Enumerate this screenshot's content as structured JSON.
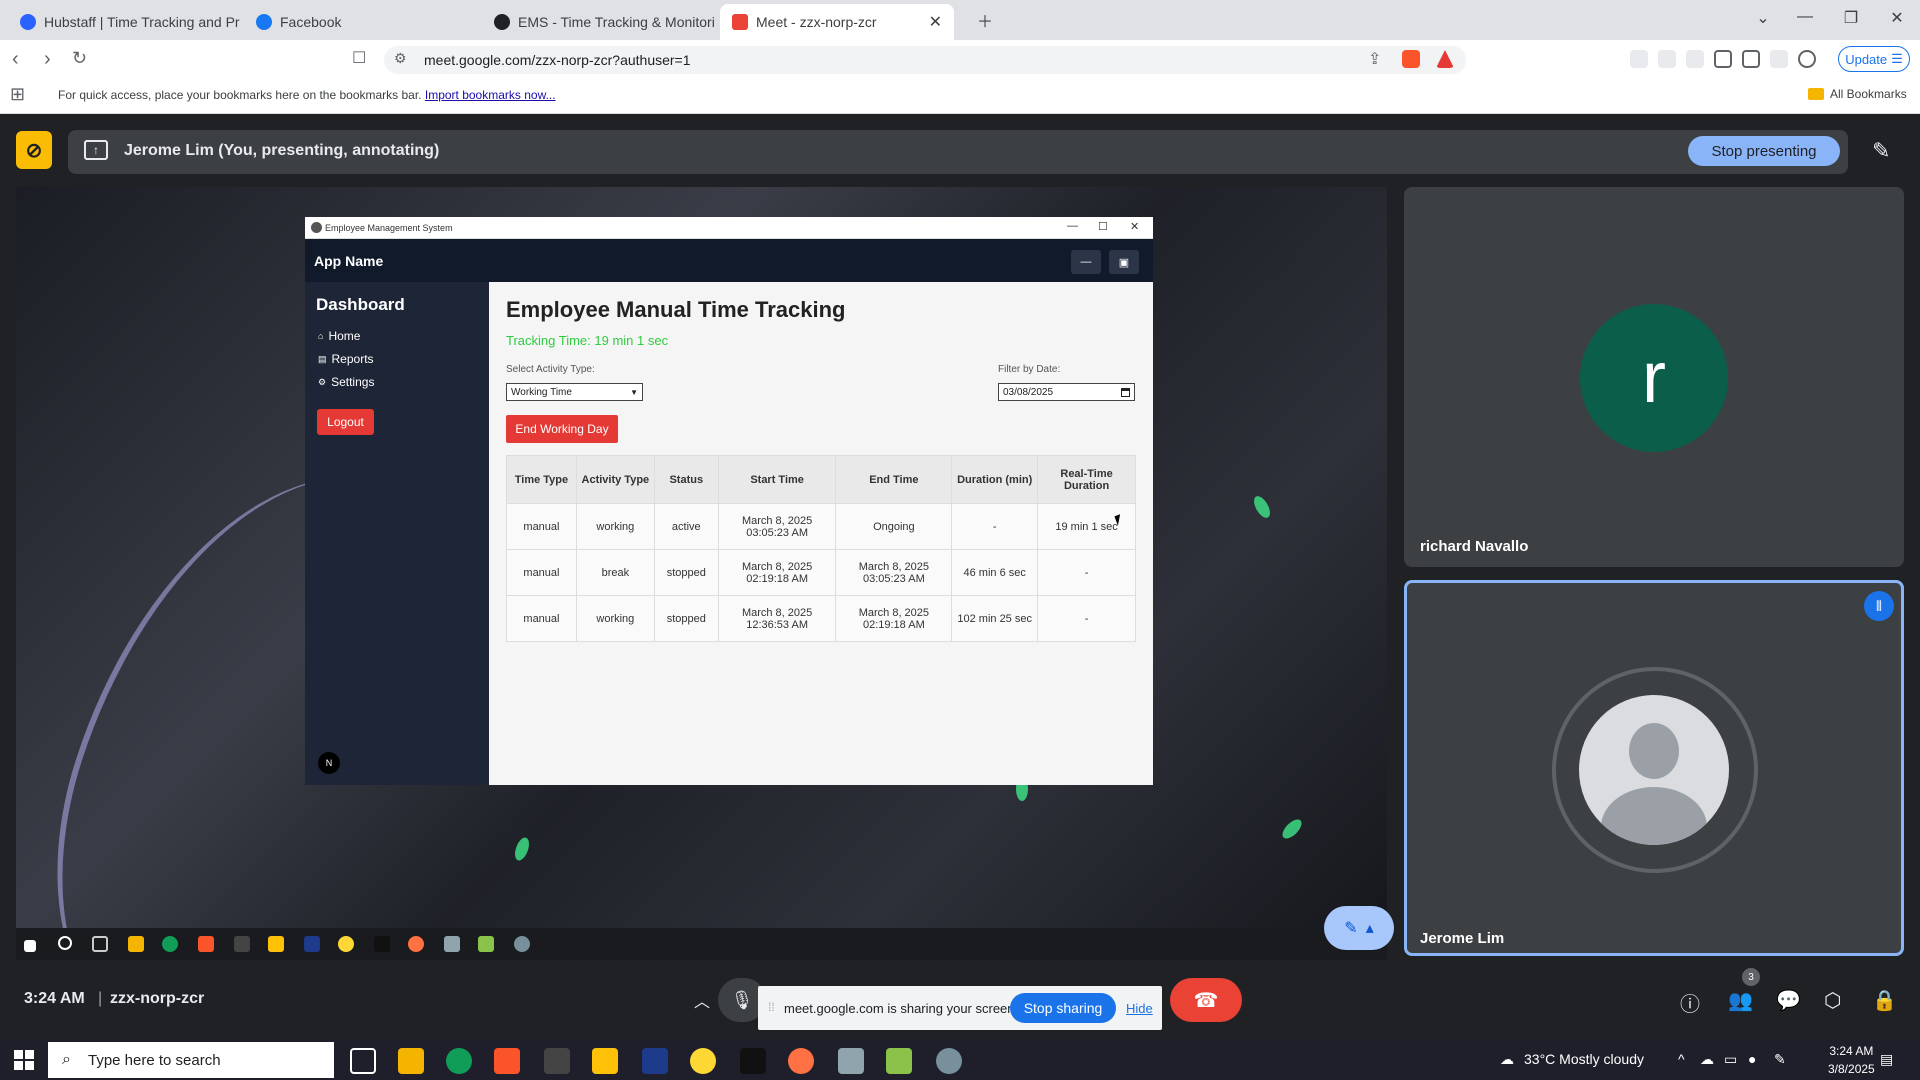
{
  "browser": {
    "tabs": [
      {
        "label": "Hubstaff | Time Tracking and Produ",
        "color": "#2962ff"
      },
      {
        "label": "Facebook",
        "color": "#1877f2"
      },
      {
        "label": "EMS - Time Tracking & Monitoring",
        "color": "#202124"
      },
      {
        "label": "Meet - zzx-norp-zcr",
        "color": "#ea4335"
      }
    ],
    "url": "meet.google.com/zzx-norp-zcr?authuser=1",
    "update_label": "Update",
    "bookmarks_prompt": "For quick access, place your bookmarks here on the bookmarks bar.",
    "import_link": "Import bookmarks now...",
    "all_bookmarks": "All Bookmarks"
  },
  "meet": {
    "presenting_title": "Jerome Lim (You, presenting, annotating)",
    "stop_presenting": "Stop presenting",
    "participants": [
      {
        "name": "richard Navallo",
        "initial": "r",
        "avatar_color": "#0b5e4a"
      },
      {
        "name": "Jerome Lim"
      }
    ],
    "time": "3:24 AM",
    "separator": "|",
    "meeting_code": "zzx-norp-zcr",
    "share_notice": "meet.google.com is sharing your screen.",
    "stop_sharing": "Stop sharing",
    "hide": "Hide",
    "people_count": "3"
  },
  "ems": {
    "window_title": "Employee Management System",
    "app_name": "App Name",
    "sidebar": {
      "title": "Dashboard",
      "items": [
        {
          "icon": "home-icon",
          "glyph": "⌂",
          "label": "Home"
        },
        {
          "icon": "reports-icon",
          "glyph": "▤",
          "label": "Reports"
        },
        {
          "icon": "settings-icon",
          "glyph": "⚙",
          "label": "Settings"
        }
      ],
      "logout": "Logout",
      "badge": "N"
    },
    "main": {
      "title": "Employee Manual Time Tracking",
      "tracking_time": "Tracking Time: 19 min 1 sec",
      "activity_label": "Select Activity Type:",
      "activity_value": "Working Time",
      "date_label": "Filter by Date:",
      "date_value": "03/08/2025",
      "end_day": "End Working Day",
      "columns": [
        "Time Type",
        "Activity Type",
        "Status",
        "Start Time",
        "End Time",
        "Duration (min)",
        "Real-Time Duration"
      ],
      "rows": [
        [
          "manual",
          "working",
          "active",
          "March 8, 2025 03:05:23 AM",
          "Ongoing",
          "-",
          "19 min 1 sec"
        ],
        [
          "manual",
          "break",
          "stopped",
          "March 8, 2025 02:19:18 AM",
          "March 8, 2025 03:05:23 AM",
          "46 min 6 sec",
          "-"
        ],
        [
          "manual",
          "working",
          "stopped",
          "March 8, 2025 12:36:53 AM",
          "March 8, 2025 02:19:18 AM",
          "102 min 25 sec",
          "-"
        ]
      ]
    }
  },
  "taskbar": {
    "search_placeholder": "Type here to search",
    "weather": "33°C  Mostly cloudy",
    "time": "3:24 AM",
    "date": "3/8/2025"
  }
}
